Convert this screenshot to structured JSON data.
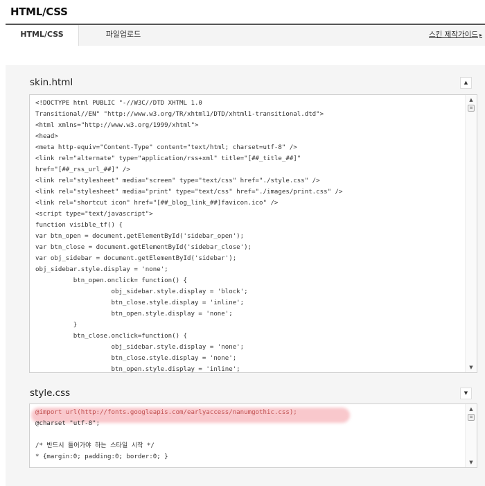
{
  "page": {
    "title": "HTML/CSS"
  },
  "tabs": [
    {
      "label": "HTML/CSS",
      "active": true
    },
    {
      "label": "파일업로드",
      "active": false
    }
  ],
  "guide_link": {
    "label": "스킨 제작가이드",
    "arrow": "▸"
  },
  "icons": {
    "collapse_up": "▲",
    "collapse_down": "▼",
    "scroll_up": "▲",
    "scroll_down": "▼",
    "grip": "≡"
  },
  "skin_html": {
    "label": "skin.html",
    "lines": [
      "<!DOCTYPE html PUBLIC \"-//W3C//DTD XHTML 1.0",
      "Transitional//EN\" \"http://www.w3.org/TR/xhtml1/DTD/xhtml1-transitional.dtd\">",
      "<html xmlns=\"http://www.w3.org/1999/xhtml\">",
      "<head>",
      "<meta http-equiv=\"Content-Type\" content=\"text/html; charset=utf-8\" />",
      "<link rel=\"alternate\" type=\"application/rss+xml\" title=\"[##_title_##]\"",
      "href=\"[##_rss_url_##]\" />",
      "<link rel=\"stylesheet\" media=\"screen\" type=\"text/css\" href=\"./style.css\" />",
      "<link rel=\"stylesheet\" media=\"print\" type=\"text/css\" href=\"./images/print.css\" />",
      "<link rel=\"shortcut icon\" href=\"[##_blog_link_##]favicon.ico\" />",
      "<script type=\"text/javascript\">",
      "function visible_tf() {",
      "var btn_open = document.getElementById('sidebar_open');",
      "var btn_close = document.getElementById('sidebar_close');",
      "var obj_sidebar = document.getElementById('sidebar');",
      "obj_sidebar.style.display = 'none';",
      "          btn_open.onclick= function() {",
      "                    obj_sidebar.style.display = 'block';",
      "                    btn_close.style.display = 'inline';",
      "                    btn_open.style.display = 'none';",
      "          }",
      "          btn_close.onclick=function() {",
      "                    obj_sidebar.style.display = 'none';",
      "                    btn_close.style.display = 'none';",
      "                    btn_open.style.display = 'inline';"
    ]
  },
  "style_css": {
    "label": "style.css",
    "lines": [
      "@import url(http://fonts.googleapis.com/earlyaccess/nanumgothic.css);",
      "@charset \"utf-8\";",
      "",
      "/* 반드시 들어가야 하는 스타일 시작 */",
      "* {margin:0; padding:0; border:0; }"
    ],
    "highlight_color": "#f06e78"
  }
}
